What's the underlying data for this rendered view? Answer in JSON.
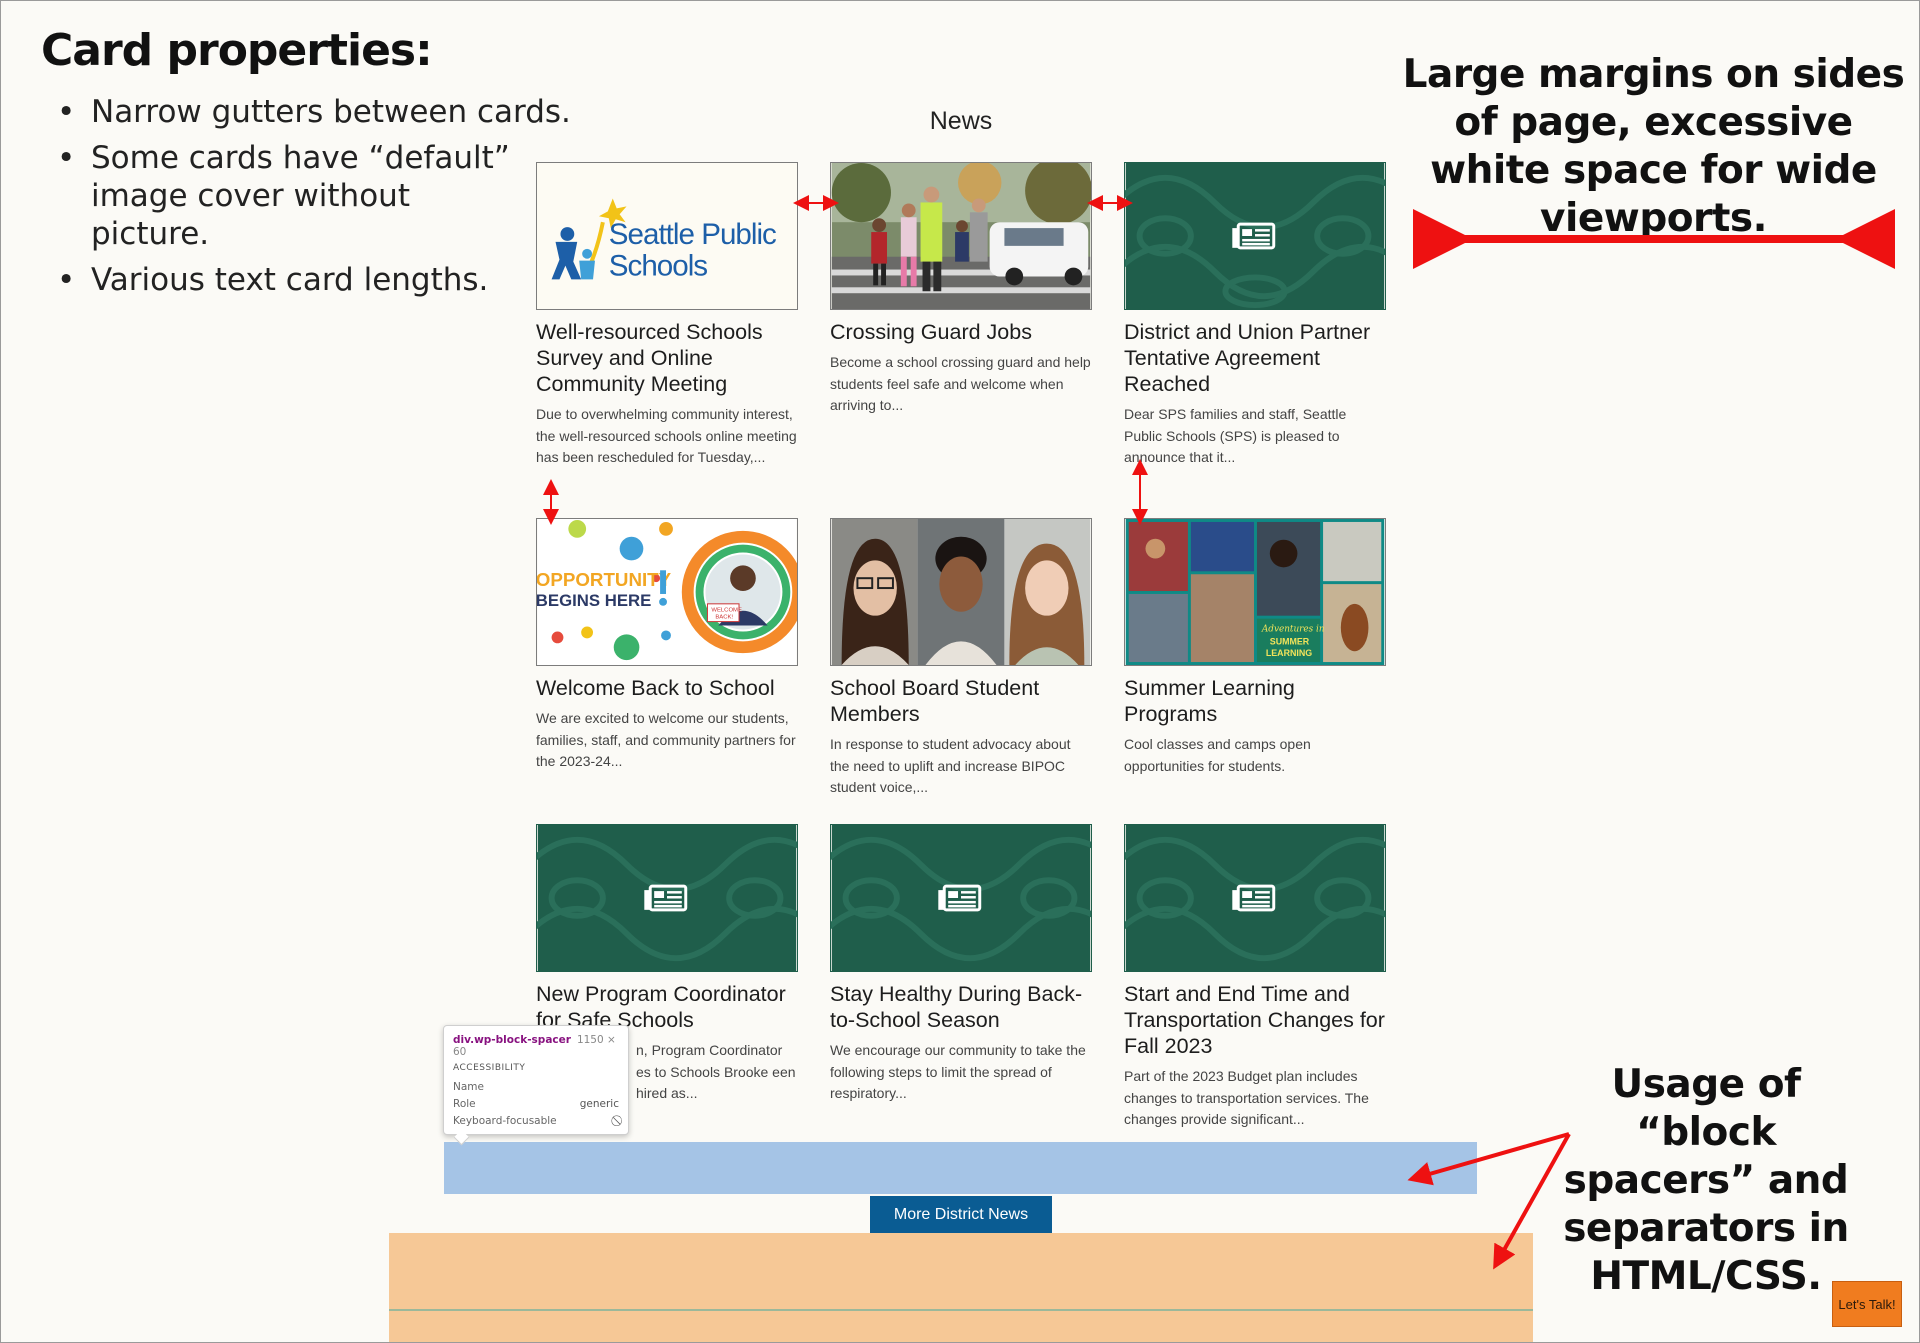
{
  "annotations": {
    "card_title": "Card properties:",
    "card_points": [
      "Narrow gutters between cards.",
      "Some cards have “default” image cover without picture.",
      "Various text card lengths."
    ],
    "margins_note": "Large margins on sides of page, excessive white space for wide viewports.",
    "spacer_note": "Usage of “block spacers” and separators in HTML/CSS."
  },
  "news": {
    "heading": "News",
    "cards": [
      {
        "title": "Well-resourced Schools Survey and Online Community Meeting",
        "excerpt": "Due to overwhelming community interest, the well-resourced schools online meeting has been rescheduled for Tuesday,...",
        "image": "sps-logo"
      },
      {
        "title": "Crossing Guard Jobs",
        "excerpt": "Become a school crossing guard and help students feel safe and welcome when arriving to...",
        "image": "crossing-guard-photo"
      },
      {
        "title": "District and Union Partner Tentative Agreement Reached",
        "excerpt": "Dear SPS families and staff, Seattle Public Schools (SPS) is pleased to announce that it...",
        "image": "default-cover"
      },
      {
        "title": "Welcome Back to School",
        "excerpt": "We are excited to welcome our students, families, staff, and community partners for the 2023-24...",
        "image": "opportunity-begins-here"
      },
      {
        "title": "School Board Student Members",
        "excerpt": "In response to student advocacy about the need to uplift and increase BIPOC student voice,...",
        "image": "student-portraits"
      },
      {
        "title": "Summer Learning Programs",
        "excerpt": "Cool classes and camps open opportunities for students.",
        "image": "summer-learning-collage"
      },
      {
        "title": "New Program Coordinator for Safe Schools",
        "excerpt": "n, Program Coordinator es to Schools Brooke een hired as...",
        "image": "default-cover"
      },
      {
        "title": "Stay Healthy During Back-to-School Season",
        "excerpt": "We encourage our community to take the following steps to limit the spread of respiratory...",
        "image": "default-cover"
      },
      {
        "title": "Start and End Time and Transportation Changes for Fall 2023",
        "excerpt": "Part of the 2023 Budget plan includes changes to transportation services. The changes provide significant...",
        "image": "default-cover"
      }
    ],
    "logo_text": [
      "Seattle Public",
      "Schools"
    ],
    "opportunity_text": [
      "OPPORTUNITY",
      "BEGINS HERE"
    ],
    "opportunity_sign": [
      "WELCOME",
      "BACK!"
    ],
    "summer_text": [
      "Adventures in",
      "SUMMER",
      "LEARNING"
    ],
    "more_button": "More District News"
  },
  "tooltip": {
    "selector": "div.wp-block-spacer",
    "dimensions": "1150 × 60",
    "section": "ACCESSIBILITY",
    "rows": [
      {
        "label": "Name",
        "value": ""
      },
      {
        "label": "Role",
        "value": "generic"
      },
      {
        "label": "Keyboard-focusable",
        "value": ""
      }
    ]
  },
  "chat_button": "Let's Talk!",
  "colors": {
    "spacer_blue": "#a5c4e6",
    "spacer_orange": "#f6c896",
    "button_blue": "#0a5c93",
    "default_cover_green": "#1f5e4b",
    "annotation_red": "#ee1111"
  }
}
